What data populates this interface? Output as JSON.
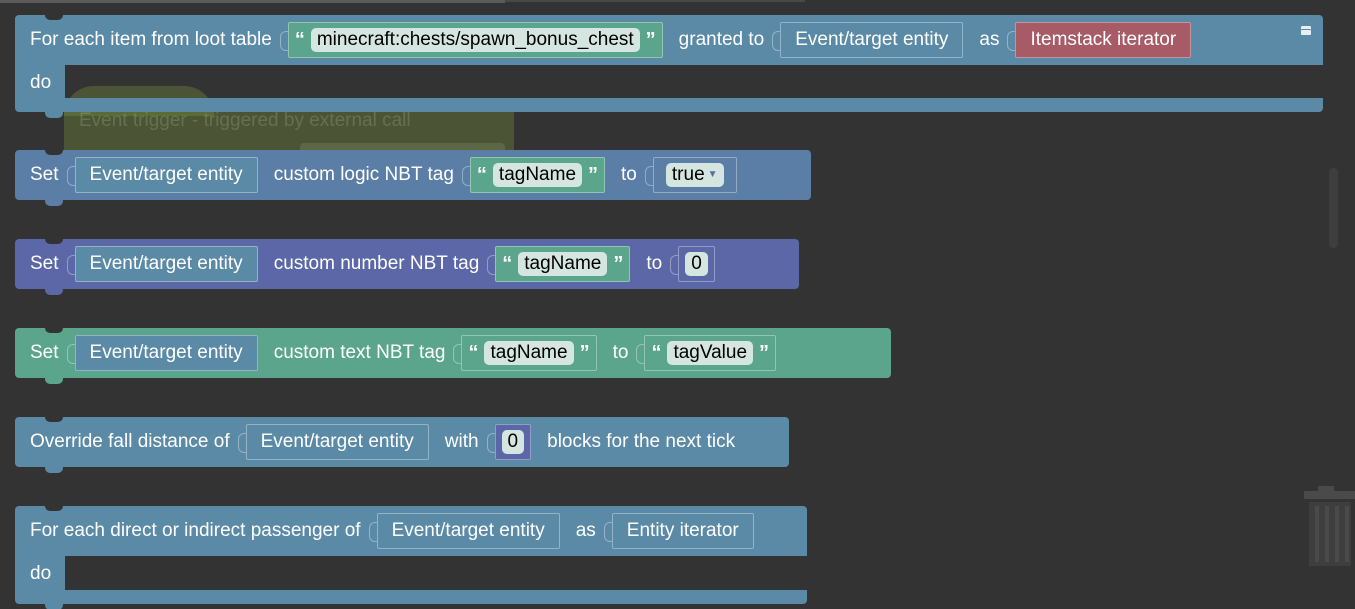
{
  "ghost": {
    "title": "Event trigger - triggered by external call"
  },
  "blocks": {
    "loot": {
      "prefix": "For each item from loot table",
      "table_value": "minecraft:chests/spawn_bonus_chest",
      "granted_to": "granted to",
      "entity": "Event/target entity",
      "as": "as",
      "iterator": "Itemstack iterator",
      "do": "do"
    },
    "logic": {
      "set": "Set",
      "entity": "Event/target entity",
      "label": "custom logic NBT tag",
      "tag": "tagName",
      "to": "to",
      "value": "true"
    },
    "number": {
      "set": "Set",
      "entity": "Event/target entity",
      "label": "custom number NBT tag",
      "tag": "tagName",
      "to": "to",
      "value": "0"
    },
    "text": {
      "set": "Set",
      "entity": "Event/target entity",
      "label": "custom text NBT tag",
      "tag": "tagName",
      "to": "to",
      "value": "tagValue"
    },
    "fall": {
      "prefix": "Override fall distance of",
      "entity": "Event/target entity",
      "with": "with",
      "value": "0",
      "suffix": "blocks for the next tick"
    },
    "passenger": {
      "prefix": "For each direct or indirect passenger of",
      "entity": "Event/target entity",
      "as": "as",
      "iterator": "Entity iterator",
      "do": "do"
    }
  },
  "quote_open": "“",
  "quote_close": "”",
  "icons": [
    "comment-icon",
    "trash-icon",
    "dropdown-arrow-icon"
  ],
  "colors": {
    "workspace": "#333333",
    "teal_blue": "#5b8aa6",
    "logic_blue": "#5b7ea6",
    "number_indigo": "#5b67a6",
    "text_green": "#5ba58c",
    "iterator_red": "#a65b66"
  }
}
